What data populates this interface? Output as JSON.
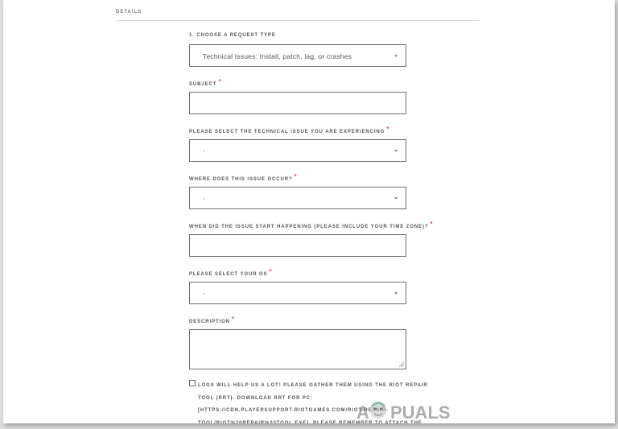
{
  "section": {
    "title": "DETAILS"
  },
  "form": {
    "request_type": {
      "label": "1. CHOOSE A REQUEST TYPE",
      "value": "Technical Issues: Install, patch, lag, or crashes"
    },
    "subject": {
      "label": "SUBJECT",
      "required_mark": "*",
      "value": ""
    },
    "technical_issue": {
      "label": "PLEASE SELECT THE TECHNICAL ISSUE YOU ARE EXPERIENCING",
      "required_mark": "*",
      "value": "-"
    },
    "issue_location": {
      "label": "WHERE DOES THIS ISSUE OCCUR?",
      "required_mark": "*",
      "value": "-"
    },
    "start_time": {
      "label": "WHEN DID THE ISSUE START HAPPENING (PLEASE INCLUDE YOUR TIME ZONE)?",
      "required_mark": "*",
      "value": ""
    },
    "os": {
      "label": "PLEASE SELECT YOUR OS",
      "required_mark": "*",
      "value": "-"
    },
    "description": {
      "label": "DESCRIPTION",
      "required_mark": "*",
      "value": ""
    },
    "logs_checkbox": {
      "checked": false,
      "text": "LOGS WILL HELP US A LOT! PLEASE GATHER THEM USING THE RIOT REPAIR TOOL (RRT). DOWNLOAD RRT FOR PC: [HTTPS://CDN.PLAYERSUPPORT.RIOTGAMES.COM/RIOT-REPAIR-TOOL/RIOT%20REPAIR%20TOOL.EXE]. PLEASE REMEMBER TO ATTACH THE FILE"
    }
  },
  "watermark": {
    "text": "APPUALS"
  },
  "colors": {
    "required": "#d9534f",
    "border": "#6d6d6d",
    "background": "#ffffff",
    "outer_background": "#dcdcdc"
  }
}
